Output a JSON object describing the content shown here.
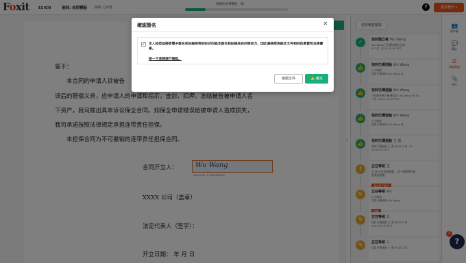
{
  "header": {
    "logo_word": "Foxit",
    "logo_sub": "ESIGN",
    "doc_title": "信封: 合同模板",
    "doc_status": "擬稿: 已共用",
    "progress_label": "剩餘的必要欄位",
    "progress_count": "0",
    "progress_fraction": 0.2,
    "help_icon": "?",
    "more_button": "更多動作 ▾"
  },
  "document": {
    "lines": [
      "鉴于：",
      "本合同的申请人诉被告",
      "误后的赔偿义务，应申请人的申请和指示，查封、扣押、冻结被告被申请人名",
      "下资产，我司兹出具本诉讼保全合同。如保全申请错误给被申请人造成损失，",
      "我司承诺按照法律规定承担连带责任担保。",
      "本担保合同为不可撤销的连带责任担保合同。",
      "合同开立人：",
      "XXXX 公司（盖章）",
      "法定代表人（签字）：",
      "开立日期：    年    月    日"
    ],
    "signature": "Wu Wang",
    "signature_caption": "Signed ID: 7F3D9A0E6B1C"
  },
  "panel": {
    "tab": "信封稽查跟踪",
    "events": [
      {
        "title": "信封建立者",
        "who": "Wu Wang",
        "desc": [
          "Wu Wang 已從範本建立信封:",
          "6 八月, 2023 05:30 PDT"
        ],
        "icon": "check-icon",
        "glyph": "✓",
        "color": "#1aae7a"
      },
      {
        "title": "信封已傳送給",
        "who": "Wu Wang",
        "desc": [
          "3 小時前",
          "信封已傳送給 Wu Wang 在"
        ],
        "icon": "thumbs-up-icon",
        "glyph": "👍",
        "color": "#1aae7a"
      },
      {
        "title": "信封已傳送給",
        "who": "Wu Wang",
        "desc": [
          "下列收件者已檢視信封: Wu Wang 在 08",
          "八月, 2023 05:30 PDT"
        ],
        "icon": "thumbs-up-icon",
        "glyph": "👍",
        "color": "#1aae7a"
      },
      {
        "title": "信封已傳送給",
        "who": "Wu Wang",
        "desc": [
          "3 小時前",
          "信封已傳送給 Wu Wang 在"
        ],
        "icon": "thumbs-up-icon",
        "glyph": "👍",
        "color": "#1aae7a"
      },
      {
        "title": "信封已傳送給",
        "who": "王 張",
        "desc": [
          "信封已傳送給 王 張 在 08 八月, 20",
          "23 05:30 PDT"
        ],
        "icon": "thumbs-up-icon",
        "glyph": "👍",
        "color": "#1aae7a"
      },
      {
        "title": "正在等候",
        "who": "王",
        "desc": [
          "王 張 正在等候簽署。 您一個選擇可能",
          "是傳送提醒。"
        ],
        "icon": "alert-icon",
        "glyph": "!",
        "color": "#e2a62c",
        "action": "傳送電子郵件"
      },
      {
        "title": "正在等候",
        "who": "Wu",
        "desc": [
          "2 小時前",
          "信封已傳送給 Wu Wang"
        ],
        "icon": "edit-icon",
        "glyph": "✎",
        "color": "#e2a62c",
        "action": "提醒"
      },
      {
        "title": "正在等候",
        "who": "三",
        "desc": [
          "信封已傳送給 三 張 在 08 八月,",
          "2023 05:30 PDT"
        ],
        "icon": "edit-icon",
        "glyph": "✎",
        "color": "#e2a62c"
      },
      {
        "title": "正在等候",
        "who": "三",
        "desc": [
          "信封已傳送給 三 張 在 08 八月,",
          ""
        ],
        "icon": "edit-icon",
        "glyph": "✎",
        "color": "#e2a62c"
      }
    ]
  },
  "toolbar": {
    "items": [
      {
        "label": "收件者",
        "icon": "people-icon",
        "glyph": "👥"
      },
      {
        "label": "備註",
        "icon": "note-icon",
        "glyph": "💬"
      },
      {
        "label": "稽查跟蹤",
        "icon": "audit-icon",
        "glyph": "☰"
      },
      {
        "label": "附件",
        "icon": "attachment-icon",
        "glyph": "📎"
      }
    ],
    "chat_badge": "3",
    "chat_glyph": "?"
  },
  "modal": {
    "title": "確認簽名",
    "close": "×",
    "consent_text": "本人知悉並接受電子簽名和記錄與等同形式的紙本簽名和記錄具有同等效力，因此兼接受與紙本文件相同的真實性法律審查。",
    "consent_link": "按一下這裡進行確認。",
    "decline_label": "檢閱文件",
    "confirm_label": "確定"
  },
  "colors": {
    "accent_green": "#1aae7a",
    "accent_orange": "#e8561a",
    "pending_yellow": "#e2a62c"
  }
}
